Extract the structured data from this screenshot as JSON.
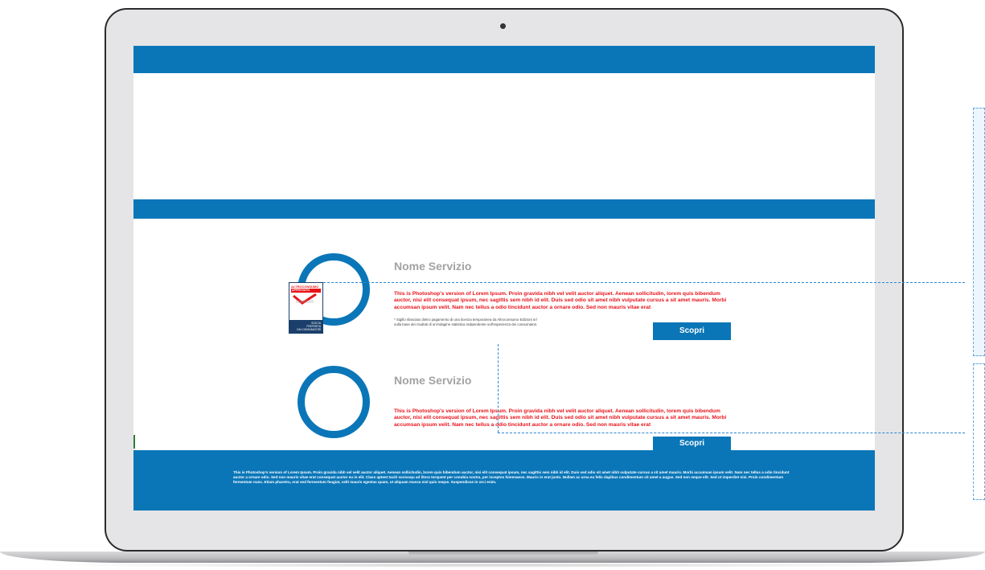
{
  "screen": {
    "services": [
      {
        "title": "Nome Servizio",
        "description": "This is Photoshop's version  of Lorem Ipsum. Proin gravida nibh vel velit auctor aliquet. Aenean sollicitudin, lorem quis bibendum auctor, nisi elit consequat ipsum, nec sagittis sem nibh id elit. Duis sed odio sit amet nibh vulputate cursus a sit amet mauris. Morbi accumsan ipsum velit. Nam nec tellus a odio tincidunt auctor a ornare odio. Sed non  mauris vitae erat",
        "disclaimer": "* Sigillo rilasciato dietro pagamento di una licenza temporanea da Altroconsumo Edizioni srl\n   sulla base dei risultati di un'indagine statistica indipendente sull'esperienza dei consumatori.",
        "button_label": "Scopri"
      },
      {
        "title": "Nome Servizio",
        "description": "This is Photoshop's version  of Lorem Ipsum. Proin gravida nibh vel velit auctor aliquet. Aenean sollicitudin, lorem quis bibendum auctor, nisi elit consequat ipsum, nec sagittis sem nibh id elit. Duis sed odio sit amet nibh vulputate cursus a sit amet mauris. Morbi accumsan ipsum velit. Nam nec tellus a odio tincidunt auctor a ornare odio. Sed non  mauris vitae erat",
        "button_label": "Scopri"
      }
    ],
    "badge": {
      "brand": "ALTROCONSUMO",
      "label": "APPROVATO",
      "footer": "SCELTA\nPREFERITA\nDAI CONSUMATORI"
    },
    "footer_text": "This is Photoshop's version  of Lorem Ipsum. Proin gravida nibh vel velit auctor aliquet. Aenean sollicitudin, lorem quis bibendum auctor, nisi elit consequat ipsum, nec sagittis sem nibh id elit. Duis sed odio sit amet nibh vulputate cursus a sit amet mauris. Morbi accumsan ipsum velit. Nam nec tellus a odio tincidunt auctor a ornare odio. Sed non  mauris vitae erat consequat auctor eu in elit. Class aptent taciti sociosqu ad litora torquent per conubia nostra, per inceptos himenaeos. Mauris in erat justo. Nullam ac urna eu felis dapibus condimentum sit amet a augue. Sed non neque elit. Sed ut imperdiet nisi. Proin condimentum fermentum nunc. Etiam pharetra, erat sed fermentum feugiat, velit mauris egestas quam, ut aliquam massa nisl quis neque. Suspendisse in orci enim."
  },
  "colors": {
    "brand_blue": "#0a76b8",
    "accent_red": "#e8141b",
    "title_gray": "#a3a3a3"
  }
}
